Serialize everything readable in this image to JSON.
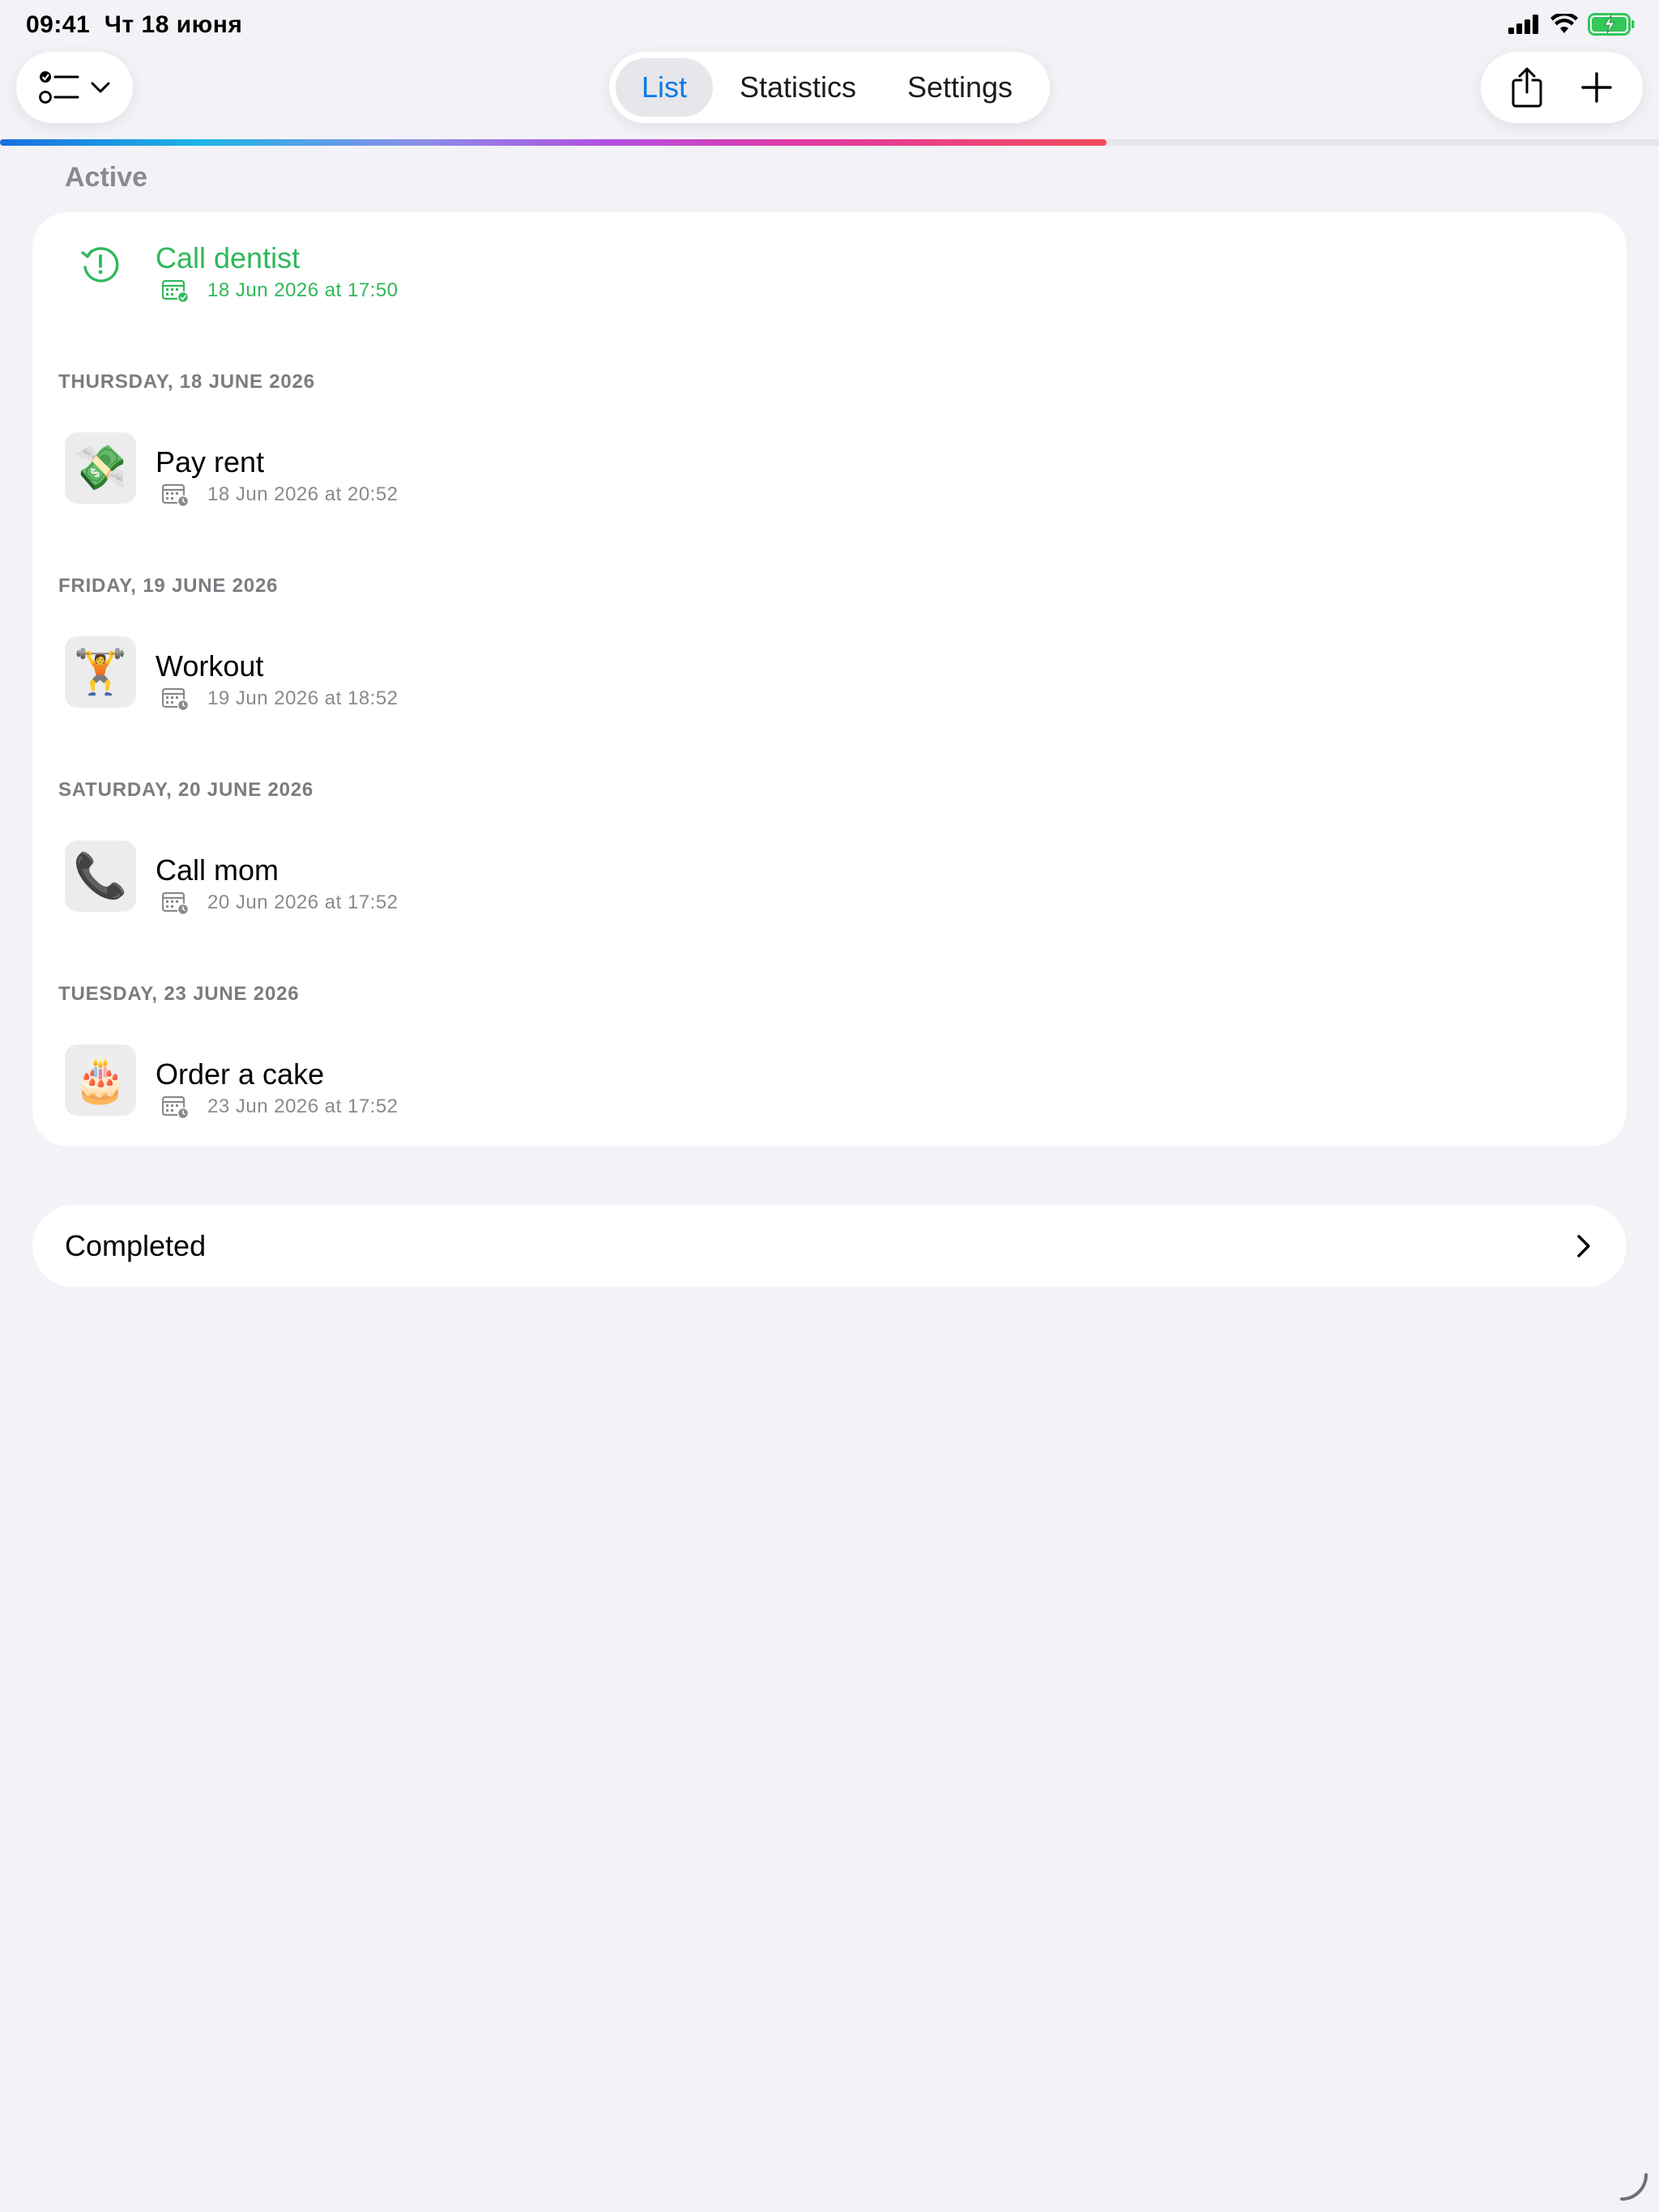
{
  "status_bar": {
    "time": "09:41",
    "date": "Чт 18 июня"
  },
  "toolbar": {
    "tabs": [
      {
        "label": "List",
        "active": true
      },
      {
        "label": "Statistics",
        "active": false
      },
      {
        "label": "Settings",
        "active": false
      }
    ],
    "progress_fraction": 0.667
  },
  "active_section": {
    "title": "Active",
    "overdue": {
      "title": "Call dentist",
      "date": "18 Jun 2026 at 17:50",
      "icon": "overdue-clock-icon"
    },
    "groups": [
      {
        "header": "THURSDAY, 18 JUNE 2026",
        "items": [
          {
            "title": "Pay rent",
            "date": "18 Jun 2026 at 20:52",
            "emoji": "💸"
          }
        ]
      },
      {
        "header": "FRIDAY, 19 JUNE 2026",
        "items": [
          {
            "title": "Workout",
            "date": "19 Jun 2026 at 18:52",
            "emoji": "🏋️"
          }
        ]
      },
      {
        "header": "SATURDAY, 20 JUNE 2026",
        "items": [
          {
            "title": "Call mom",
            "date": "20 Jun 2026 at 17:52",
            "emoji": "📞"
          }
        ]
      },
      {
        "header": "TUESDAY, 23 JUNE 2026",
        "items": [
          {
            "title": "Order a cake",
            "date": "23 Jun 2026 at 17:52",
            "emoji": "🎂"
          }
        ]
      }
    ]
  },
  "completed_section": {
    "label": "Completed"
  },
  "colors": {
    "accent_blue": "#0a7ae8",
    "overdue_green": "#2fb85a",
    "background": "#f2f2f7"
  }
}
